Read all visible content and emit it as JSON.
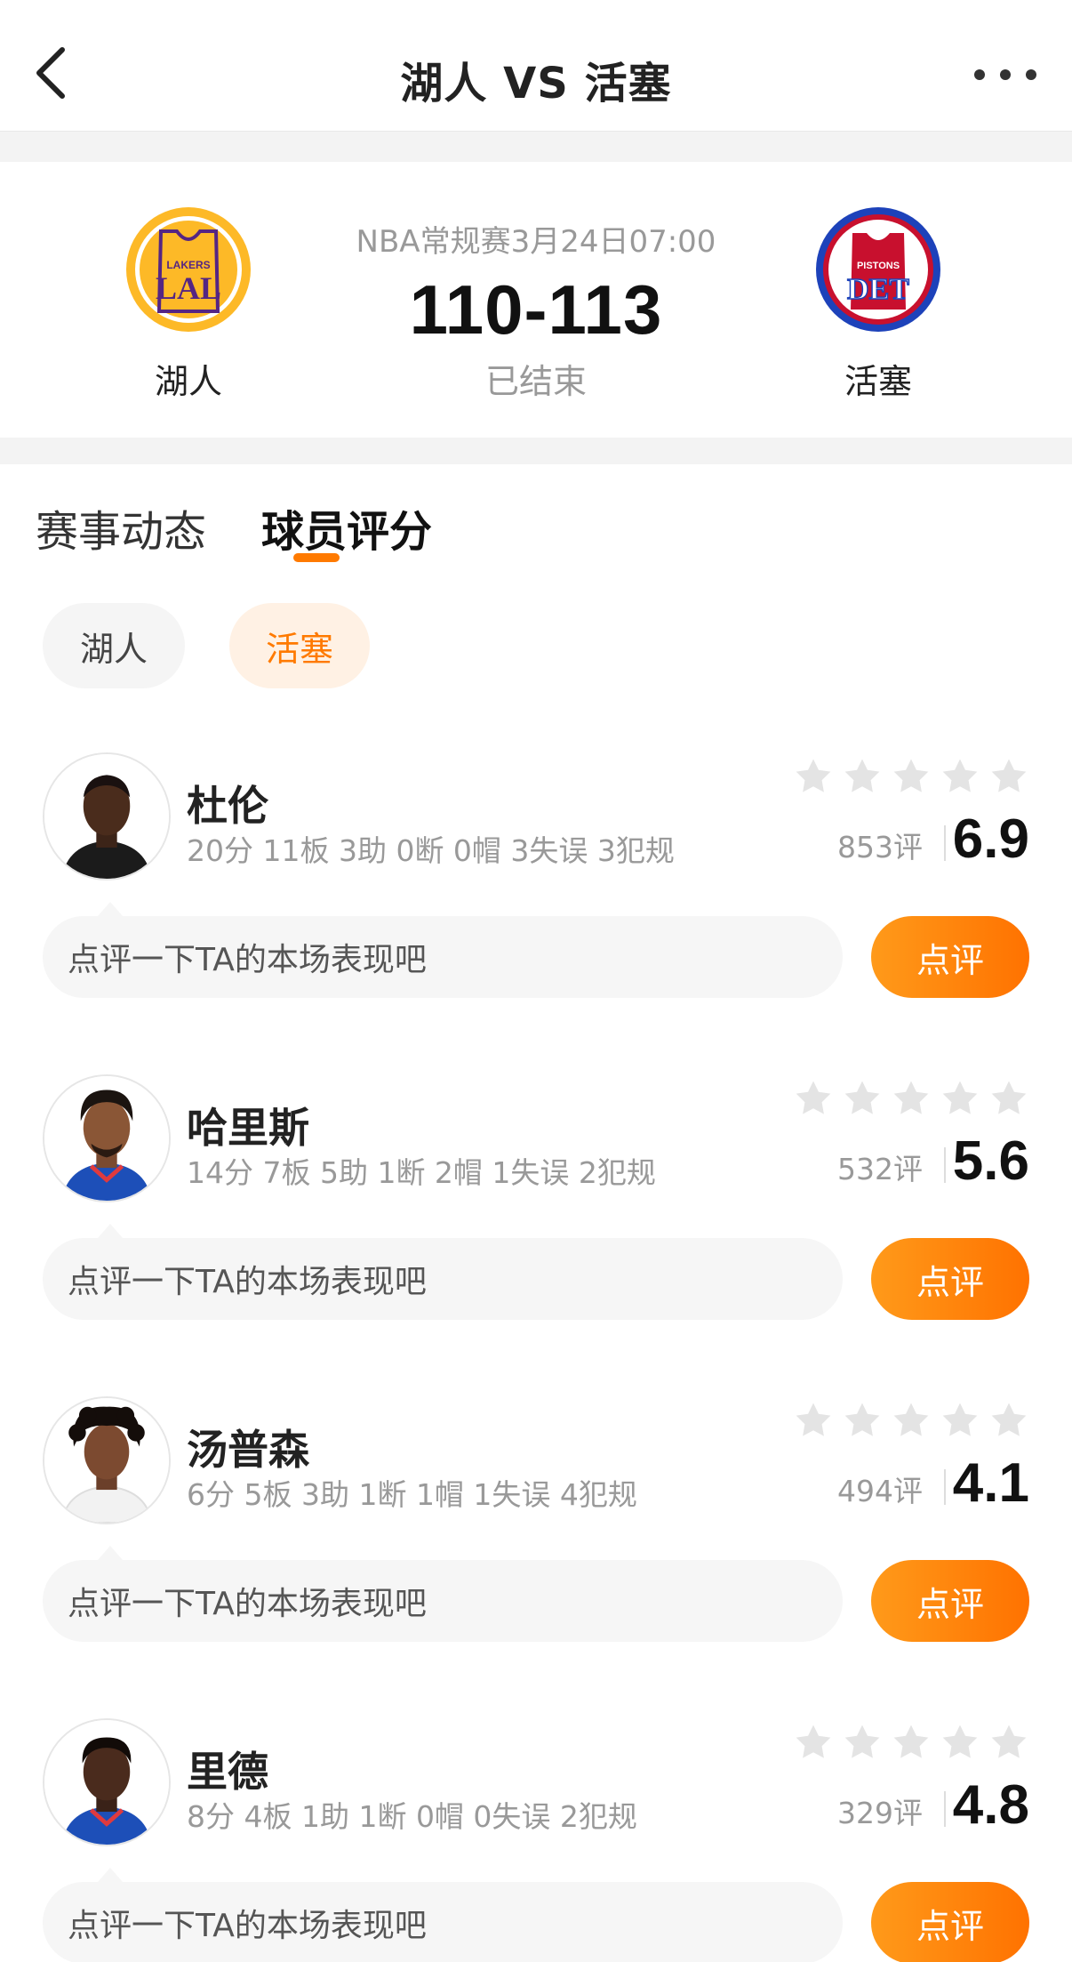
{
  "nav": {
    "title": "湖人 VS 活塞"
  },
  "match": {
    "info": "NBA常规赛3月24日07:00",
    "score": "110-113",
    "status": "已结束",
    "home": {
      "name": "湖人",
      "logo_text_top": "LAKERS",
      "logo_text_main": "LAL",
      "colors": {
        "primary": "#552583",
        "secondary": "#FDB927"
      }
    },
    "away": {
      "name": "活塞",
      "logo_text_top": "PISTONS",
      "logo_text_main": "DET",
      "colors": {
        "primary": "#1D42BA",
        "secondary": "#C8102E"
      }
    }
  },
  "tabs": {
    "events": "赛事动态",
    "ratings": "球员评分"
  },
  "filters": {
    "lakers": "湖人",
    "pistons": "活塞"
  },
  "players": [
    {
      "name": "杜伦",
      "stats": "20分 11板 3助 0断 0帽 3失误 3犯规",
      "votes": "853评",
      "rating": "6.9",
      "comment_placeholder": "点评一下TA的本场表现吧",
      "comment_btn": "点评"
    },
    {
      "name": "哈里斯",
      "stats": "14分 7板 5助 1断 2帽 1失误 2犯规",
      "votes": "532评",
      "rating": "5.6",
      "comment_placeholder": "点评一下TA的本场表现吧",
      "comment_btn": "点评"
    },
    {
      "name": "汤普森",
      "stats": "6分 5板 3助 1断 1帽 1失误 4犯规",
      "votes": "494评",
      "rating": "4.1",
      "comment_placeholder": "点评一下TA的本场表现吧",
      "comment_btn": "点评"
    },
    {
      "name": "里德",
      "stats": "8分 4板 1助 1断 0帽 0失误 2犯规",
      "votes": "329评",
      "rating": "4.8",
      "comment_placeholder": "点评一下TA的本场表现吧",
      "comment_btn": "点评"
    }
  ],
  "theme": {
    "accent": "#FF7A00",
    "star_empty": "#E4E4E4"
  }
}
